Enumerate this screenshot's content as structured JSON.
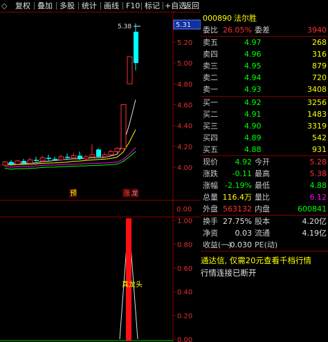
{
  "toolbar": {
    "buttons": [
      "复权",
      "叠加",
      "多股",
      "统计",
      "画线",
      "F10",
      "标记",
      "+自选",
      "返回"
    ],
    "close_glyph": "◇"
  },
  "chart": {
    "price_tag": "5.31",
    "high_label": "5.38",
    "price_axis": [
      "5.20",
      "5.00",
      "4.80",
      "4.60",
      "4.40",
      "4.20",
      "4.00"
    ],
    "mid_axis": [
      "0.00"
    ],
    "lower_axis": [
      "1.00",
      "0.80",
      "0.60",
      "0.40",
      "0.20",
      "0.00"
    ],
    "tags": {
      "forecast": "预",
      "limit": "涨",
      "dragon": "龙"
    },
    "indicator_label": "真龙头",
    "candles": [
      {
        "o": 4.02,
        "c": 4.05,
        "h": 4.06,
        "l": 4.01,
        "up": true
      },
      {
        "o": 4.05,
        "c": 4.03,
        "h": 4.07,
        "l": 4.02,
        "up": false
      },
      {
        "o": 4.03,
        "c": 4.06,
        "h": 4.07,
        "l": 4.02,
        "up": true
      },
      {
        "o": 4.06,
        "c": 4.04,
        "h": 4.08,
        "l": 4.03,
        "up": false
      },
      {
        "o": 4.04,
        "c": 4.07,
        "h": 4.09,
        "l": 4.03,
        "up": true
      },
      {
        "o": 4.07,
        "c": 4.06,
        "h": 4.1,
        "l": 4.05,
        "up": false
      },
      {
        "o": 4.06,
        "c": 4.09,
        "h": 4.11,
        "l": 4.05,
        "up": true
      },
      {
        "o": 4.09,
        "c": 4.08,
        "h": 4.12,
        "l": 4.06,
        "up": false
      },
      {
        "o": 4.08,
        "c": 4.07,
        "h": 4.1,
        "l": 4.06,
        "up": false
      },
      {
        "o": 4.07,
        "c": 4.1,
        "h": 4.12,
        "l": 4.06,
        "up": true
      },
      {
        "o": 4.1,
        "c": 4.09,
        "h": 4.13,
        "l": 4.08,
        "up": false
      },
      {
        "o": 4.09,
        "c": 4.11,
        "h": 4.14,
        "l": 4.08,
        "up": true
      },
      {
        "o": 4.11,
        "c": 4.08,
        "h": 4.15,
        "l": 4.07,
        "up": false
      },
      {
        "o": 4.08,
        "c": 4.1,
        "h": 4.12,
        "l": 4.07,
        "up": true
      },
      {
        "o": 4.1,
        "c": 4.12,
        "h": 4.22,
        "l": 4.09,
        "up": true
      },
      {
        "o": 4.17,
        "c": 4.1,
        "h": 4.18,
        "l": 4.09,
        "up": false
      },
      {
        "o": 4.1,
        "c": 4.12,
        "h": 4.14,
        "l": 4.09,
        "up": true
      },
      {
        "o": 4.12,
        "c": 4.15,
        "h": 4.17,
        "l": 4.11,
        "up": true
      },
      {
        "o": 4.15,
        "c": 4.18,
        "h": 4.19,
        "l": 4.14,
        "up": true
      },
      {
        "o": 4.18,
        "c": 4.6,
        "h": 4.6,
        "l": 4.17,
        "up": true
      },
      {
        "o": 4.8,
        "c": 5.06,
        "h": 5.06,
        "l": 4.8,
        "up": true
      },
      {
        "o": 5.0,
        "c": 5.3,
        "h": 5.38,
        "l": 4.93,
        "up": false
      }
    ]
  },
  "panel": {
    "code": "000890",
    "name": "法尔胜",
    "weibi_label": "委比",
    "weibi_value": "26.05%",
    "weicha_label": "委差",
    "weicha_value": "3940",
    "asks": [
      {
        "label": "卖五",
        "price": "4.97",
        "vol": "268"
      },
      {
        "label": "卖四",
        "price": "4.96",
        "vol": "316"
      },
      {
        "label": "卖三",
        "price": "4.95",
        "vol": "879"
      },
      {
        "label": "卖二",
        "price": "4.94",
        "vol": "720"
      },
      {
        "label": "卖一",
        "price": "4.93",
        "vol": "3408"
      }
    ],
    "bids": [
      {
        "label": "买一",
        "price": "4.92",
        "vol": "3256"
      },
      {
        "label": "买二",
        "price": "4.91",
        "vol": "1483"
      },
      {
        "label": "买三",
        "price": "4.90",
        "vol": "3319"
      },
      {
        "label": "买四",
        "price": "4.89",
        "vol": "542"
      },
      {
        "label": "买五",
        "price": "4.88",
        "vol": "931"
      }
    ],
    "stats": [
      {
        "l1": "现价",
        "v1": "4.92",
        "l2": "今开",
        "v2": "5.28"
      },
      {
        "l1": "涨跌",
        "v1": "-0.11",
        "l2": "最高",
        "v2": "5.38"
      },
      {
        "l1": "涨幅",
        "v1": "-2.19%",
        "l2": "最低",
        "v2": "4.88"
      },
      {
        "l1": "总量",
        "v1": "116.4万",
        "l2": "量比",
        "v2": "6.12"
      },
      {
        "l1": "外盘",
        "v1": "563132",
        "l2": "内盘",
        "v2": "600841"
      }
    ],
    "fin": [
      {
        "l1": "换手",
        "v1": "27.75%",
        "l2": "股本",
        "v2": "4.20亿"
      },
      {
        "l1": "净资",
        "v1": "0.03",
        "l2": "流通",
        "v2": "4.19亿"
      },
      {
        "l1": "收益(一)",
        "v1": "-0.030",
        "l2": "PE(动)",
        "v2": ""
      }
    ],
    "promo": "通达信, 仅需20元查看千档行情",
    "status": "行情连接已断开"
  },
  "colors": {
    "up": "#ff3030",
    "down": "#00ffff",
    "flat": "#e0e0e0",
    "yellow": "#ffff00",
    "grid": "#8b0000"
  }
}
